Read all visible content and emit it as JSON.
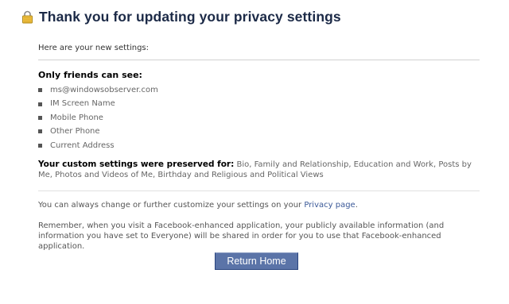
{
  "header": {
    "icon": "lock-icon",
    "title": "Thank you for updating your privacy settings"
  },
  "intro": "Here are your new settings:",
  "friends_section": {
    "heading": "Only friends can see:",
    "items": [
      "ms@windowsobserver.com",
      "IM Screen Name",
      "Mobile Phone",
      "Other Phone",
      "Current Address"
    ]
  },
  "preserved": {
    "label": "Your custom settings were preserved for:",
    "text": " Bio, Family and Relationship, Education and Work, Posts by Me, Photos and Videos of Me, Birthday and Religious and Political Views"
  },
  "change_note": {
    "prefix": "You can always change or further customize your settings on your ",
    "link": "Privacy page",
    "suffix": "."
  },
  "reminder": "Remember, when you visit a Facebook-enhanced application, your publicly available information (and information you have set to Everyone) will be shared in order for you to use that Facebook-enhanced application.",
  "return_button": "Return Home",
  "colors": {
    "title": "#1c2a47",
    "link": "#3b5998",
    "button": "#5b74a8"
  }
}
